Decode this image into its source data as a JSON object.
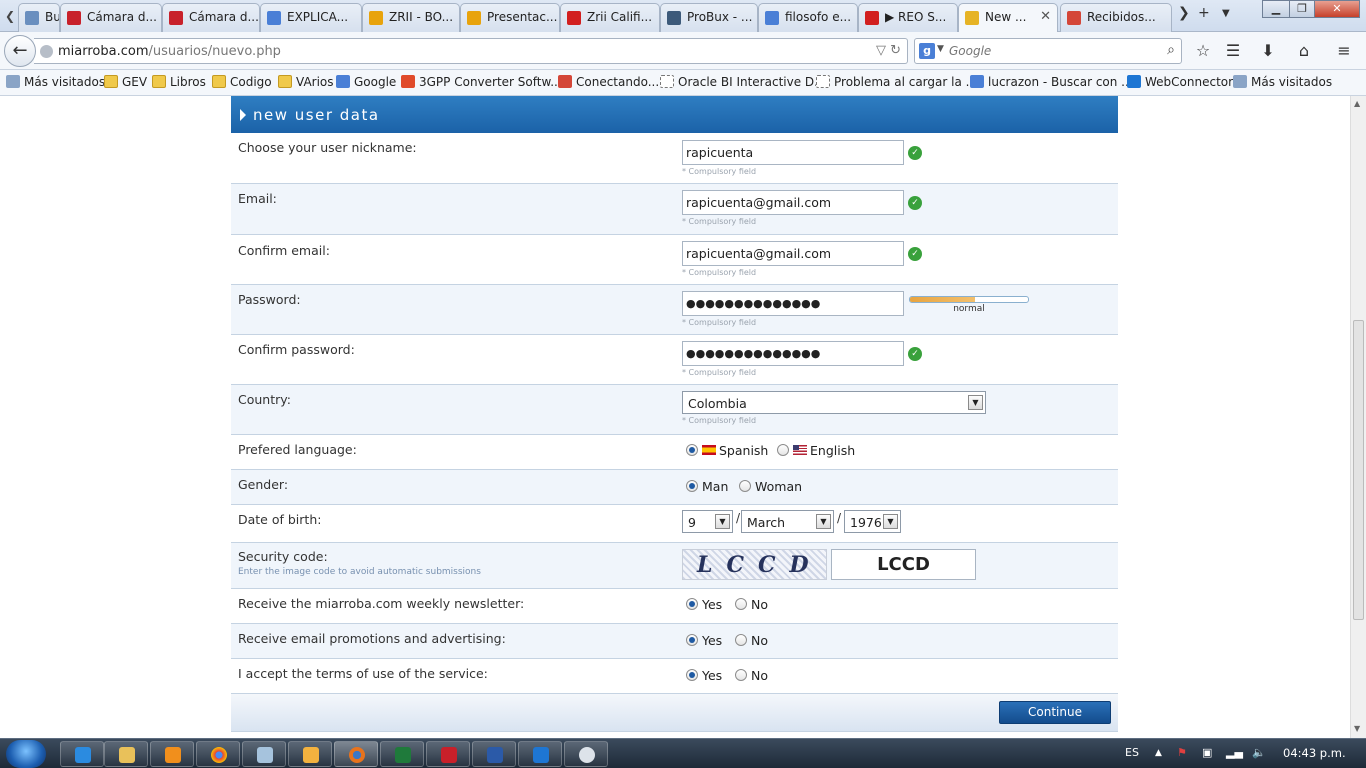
{
  "browser": {
    "tabs": [
      {
        "label": "Bus...",
        "icon_color": "#6a8fbf"
      },
      {
        "label": "Cámara d...",
        "icon_color": "#c8212b"
      },
      {
        "label": "Cámara d...",
        "icon_color": "#c8212b"
      },
      {
        "label": "EXPLICA...",
        "icon_color": "#4a7fd6"
      },
      {
        "label": "ZRII - BO...",
        "icon_color": "#e8a30c"
      },
      {
        "label": "Presentac...",
        "icon_color": "#e8a30c"
      },
      {
        "label": "Zrii Califi...",
        "icon_color": "#d21f1f"
      },
      {
        "label": "ProBux - ...",
        "icon_color": "#3d5a7a"
      },
      {
        "label": "filosofo e...",
        "icon_color": "#4a7fd6"
      },
      {
        "label": "▶ REO S...",
        "icon_color": "#d21f1f"
      },
      {
        "label": "New ...",
        "icon_color": "#e6b325"
      },
      {
        "label": "Recibidos...",
        "icon_color": "#d44638"
      }
    ],
    "active_tab_index": 10,
    "url_domain": "miarroba.com",
    "url_path": "/usuarios/nuevo.php",
    "search_placeholder": "Google",
    "bookmarks": [
      {
        "label": "Más visitados",
        "icon": "bookmark-icon"
      },
      {
        "label": "GEV",
        "icon": "folder-icon"
      },
      {
        "label": "Libros",
        "icon": "folder-icon"
      },
      {
        "label": "Codigo",
        "icon": "folder-icon"
      },
      {
        "label": "VArios",
        "icon": "folder-icon"
      },
      {
        "label": "Google",
        "icon": "google-icon"
      },
      {
        "label": "3GPP Converter Softw...",
        "icon": "windows-icon"
      },
      {
        "label": "Conectando...",
        "icon": "gmail-icon"
      },
      {
        "label": "Oracle BI Interactive D...",
        "icon": "page-icon"
      },
      {
        "label": "Problema al cargar la ...",
        "icon": "page-icon"
      },
      {
        "label": "lucrazon - Buscar con ...",
        "icon": "google-icon"
      },
      {
        "label": "WebConnector",
        "icon": "teamviewer-icon"
      },
      {
        "label": "Más visitados",
        "icon": "bookmark-icon"
      }
    ]
  },
  "form": {
    "title": "new user data",
    "compulsory_text": "* Compulsory field",
    "nickname": {
      "label": "Choose your user nickname:",
      "value": "rapicuenta"
    },
    "email": {
      "label": "Email:",
      "value": "rapicuenta@gmail.com"
    },
    "confirm_email": {
      "label": "Confirm email:",
      "value": "rapicuenta@gmail.com"
    },
    "password": {
      "label": "Password:",
      "value": "●●●●●●●●●●●●●●",
      "strength_label": "normal",
      "strength_fraction": 0.55
    },
    "confirm_password": {
      "label": "Confirm password:",
      "value": "●●●●●●●●●●●●●●"
    },
    "country": {
      "label": "Country:",
      "value": "Colombia"
    },
    "language": {
      "label": "Prefered language:",
      "options": [
        "Spanish",
        "English"
      ],
      "selected": "Spanish"
    },
    "gender": {
      "label": "Gender:",
      "options": [
        "Man",
        "Woman"
      ],
      "selected": "Man"
    },
    "birth": {
      "label": "Date of birth:",
      "day": "9",
      "month": "March",
      "year": "1976",
      "separator": "/"
    },
    "security": {
      "label": "Security code:",
      "hint": "Enter the image code to avoid automatic submissions",
      "captcha_text": "LCCD",
      "value": "LCCD"
    },
    "newsletter": {
      "label": "Receive the miarroba.com weekly newsletter:",
      "yes": "Yes",
      "no": "No",
      "selected": "Yes"
    },
    "promotions": {
      "label": "Receive email promotions and advertising:",
      "yes": "Yes",
      "no": "No",
      "selected": "Yes"
    },
    "terms": {
      "label": "I accept the terms of use of the service:",
      "yes": "Yes",
      "no": "No",
      "selected": "Yes"
    },
    "continue_label": "Continue"
  },
  "taskbar": {
    "language": "ES",
    "clock": "04:43 p.m."
  }
}
